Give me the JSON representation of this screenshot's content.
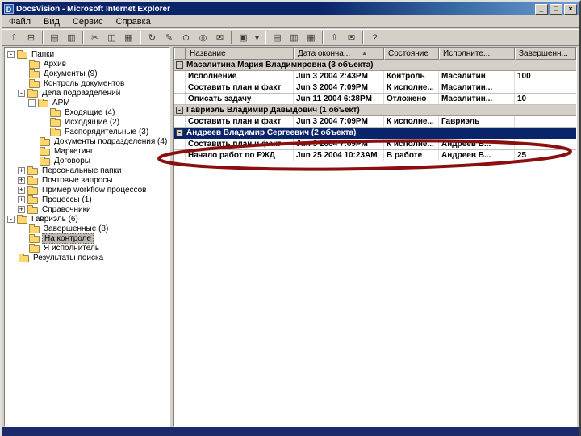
{
  "window": {
    "title": "DocsVision - Microsoft Internet Explorer",
    "app_icon_letter": "D",
    "buttons": {
      "minimize": "_",
      "maximize": "□",
      "close": "×"
    }
  },
  "menu": {
    "items": [
      "Файл",
      "Вид",
      "Сервис",
      "Справка"
    ]
  },
  "toolbar": {
    "buttons": [
      {
        "name": "up-level-icon",
        "glyph": "⇧"
      },
      {
        "name": "new-folder-icon",
        "glyph": "⊞"
      },
      {
        "name": "new-document-icon",
        "glyph": "▤"
      },
      {
        "name": "open-document-icon",
        "glyph": "▥"
      },
      {
        "name": "cut-icon",
        "glyph": "✂"
      },
      {
        "name": "copy-icon",
        "glyph": "◫"
      },
      {
        "name": "paste-icon",
        "glyph": "▦"
      },
      {
        "name": "refresh-icon",
        "glyph": "↻"
      },
      {
        "name": "properties-icon",
        "glyph": "✎"
      },
      {
        "name": "search-icon",
        "glyph": "⊙"
      },
      {
        "name": "find-icon",
        "glyph": "◎"
      },
      {
        "name": "mail-icon",
        "glyph": "✉"
      },
      {
        "name": "new-task-icon",
        "glyph": "▣"
      },
      {
        "name": "dropdown-arrow-icon",
        "glyph": "▾"
      },
      {
        "name": "view-large-icons-icon",
        "glyph": "▤"
      },
      {
        "name": "view-list-icon",
        "glyph": "▥"
      },
      {
        "name": "view-details-icon",
        "glyph": "▦"
      },
      {
        "name": "up-icon",
        "glyph": "⇧"
      },
      {
        "name": "send-icon",
        "glyph": "✉"
      },
      {
        "name": "help-icon",
        "glyph": "?"
      }
    ]
  },
  "tree": {
    "items": [
      {
        "exp": "-",
        "label": "Папки"
      },
      {
        "exp": "",
        "label": "Архив"
      },
      {
        "exp": "",
        "label": "Документы (9)"
      },
      {
        "exp": "",
        "label": "Контроль документов"
      },
      {
        "exp": "-",
        "label": "Дела подразделений"
      },
      {
        "exp": "-",
        "label": "АРМ"
      },
      {
        "exp": "",
        "label": "Входящие (4)"
      },
      {
        "exp": "",
        "label": "Исходящие (2)"
      },
      {
        "exp": "",
        "label": "Распорядительные (3)"
      },
      {
        "exp": "",
        "label": "Документы подразделения (4)"
      },
      {
        "exp": "",
        "label": "Маркетинг"
      },
      {
        "exp": "",
        "label": "Договоры"
      },
      {
        "exp": "+",
        "label": "Персональные папки"
      },
      {
        "exp": "+",
        "label": "Почтовые запросы"
      },
      {
        "exp": "+",
        "label": "Пример workflow процессов"
      },
      {
        "exp": "+",
        "label": "Процессы (1)"
      },
      {
        "exp": "+",
        "label": "Справочники"
      },
      {
        "exp": "-",
        "label": "Гавриэль (6)"
      },
      {
        "exp": "",
        "label": "Завершенные (8)"
      },
      {
        "exp": "",
        "label": "На контроле"
      },
      {
        "exp": "",
        "label": "Я исполнитель"
      },
      {
        "exp": "",
        "label": "Результаты поиска"
      }
    ]
  },
  "list": {
    "columns": [
      {
        "label": "Название",
        "sort": ""
      },
      {
        "label": "Дата оконча...",
        "sort": "▲"
      },
      {
        "label": "Состояние",
        "sort": ""
      },
      {
        "label": "Исполните...",
        "sort": ""
      },
      {
        "label": "Завершенн...",
        "sort": ""
      }
    ],
    "group_glyph": "-",
    "rows": [
      {
        "kind": "group",
        "text": "Масалитина Мария Владимировна (3 объекта)"
      },
      {
        "kind": "item",
        "name": "Исполнение",
        "date": "Jun 3 2004 2:43PM",
        "state": "Контроль",
        "assignee": "Масалитин",
        "done": "100"
      },
      {
        "kind": "item",
        "name": "Составить план и факт",
        "date": "Jun 3 2004 7:09PM",
        "state": "К исполне...",
        "assignee": "Масалитин...",
        "done": ""
      },
      {
        "kind": "item",
        "name": "Описать задачу",
        "date": "Jun 11 2004 6:38PM",
        "state": "Отложено",
        "assignee": "Масалитин...",
        "done": "10"
      },
      {
        "kind": "group",
        "text": "Гавриэль Владимир Давыдович (1 объект)"
      },
      {
        "kind": "item",
        "name": "Составить план и факт",
        "date": "Jun 3 2004 7:09PM",
        "state": "К исполне...",
        "assignee": "Гавриэль",
        "done": ""
      },
      {
        "kind": "group",
        "text": "Андреев Владимир Сергеевич (2 объекта)"
      },
      {
        "kind": "item",
        "name": "Составить план и факт",
        "date": "Jun 3 2004 7:09PM",
        "state": "К исполне...",
        "assignee": "Андреев В...",
        "done": ""
      },
      {
        "kind": "item",
        "name": "Начало работ по РЖД",
        "date": "Jun 25 2004 10:23AM",
        "state": "В работе",
        "assignee": "Андреев В...",
        "done": "25"
      }
    ]
  },
  "annotation": {
    "shape": "ellipse",
    "color": "#8b0f0f"
  }
}
